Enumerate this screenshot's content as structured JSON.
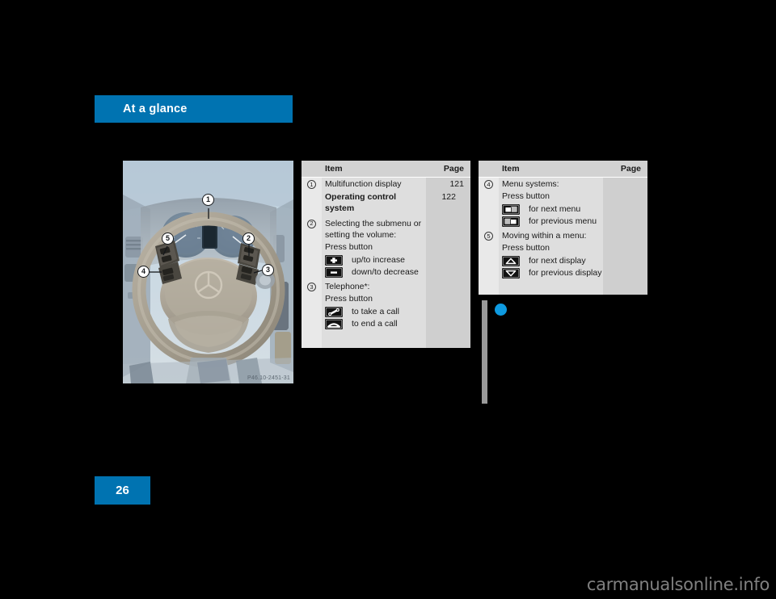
{
  "chapter": {
    "banner_title": "At a glance"
  },
  "illustration": {
    "figure_code": "P46.10-2451-31",
    "callouts": [
      "1",
      "2",
      "3",
      "4",
      "5"
    ]
  },
  "tables": {
    "left": {
      "header": {
        "item": "Item",
        "page": "Page"
      },
      "rows": [
        {
          "number": "1",
          "text": "Multifunction display",
          "page": "121",
          "bold": false
        },
        {
          "number": "",
          "text": "Operating control system",
          "page": "122",
          "bold": true
        },
        {
          "number": "2",
          "text": "Selecting the submenu or setting the volume:\nPress button",
          "page": "",
          "bold": false,
          "icons": [
            {
              "icon": "plus-button-icon",
              "label": "up/to increase"
            },
            {
              "icon": "minus-button-icon",
              "label": "down/to decrease"
            }
          ]
        },
        {
          "number": "3",
          "text": "Telephone*:\nPress button",
          "page": "",
          "bold": false,
          "icons": [
            {
              "icon": "handset-lift-icon",
              "label": "to take a call"
            },
            {
              "icon": "handset-hangup-icon",
              "label": "to end a call"
            }
          ]
        }
      ]
    },
    "right": {
      "header": {
        "item": "Item",
        "page": "Page"
      },
      "rows": [
        {
          "number": "4",
          "text": "Menu systems:\nPress button",
          "page": "",
          "bold": false,
          "icons": [
            {
              "icon": "next-menu-icon",
              "label": "for next menu"
            },
            {
              "icon": "previous-menu-icon",
              "label": "for previous menu"
            }
          ]
        },
        {
          "number": "5",
          "text": "Moving within a menu:\nPress button",
          "page": "",
          "bold": false,
          "icons": [
            {
              "icon": "arrow-up-button-icon",
              "label": "for next display"
            },
            {
              "icon": "arrow-down-button-icon",
              "label": "for previous display"
            }
          ]
        }
      ]
    }
  },
  "footer": {
    "page_number": "26",
    "watermark": "carmanualsonline.info"
  },
  "colors": {
    "brand_blue": "#0073b1",
    "index_dot_blue": "#0e9ae0",
    "table_bg": "#dedede",
    "table_header_bg": "#d2d2d2",
    "page_column_bg": "#cfcfcf"
  }
}
